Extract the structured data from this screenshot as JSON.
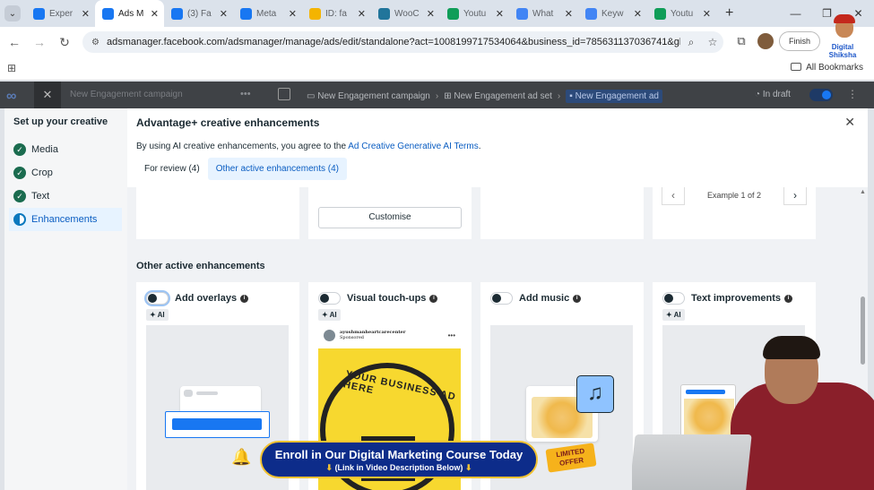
{
  "browser": {
    "tabs": [
      {
        "label": "Exper",
        "color": "#1877f2",
        "icon": "meta-icon"
      },
      {
        "label": "Ads M",
        "color": "#1877f2",
        "icon": "meta-icon",
        "active": true
      },
      {
        "label": "(3) Fa",
        "color": "#1877f2",
        "icon": "facebook-icon"
      },
      {
        "label": "Meta",
        "color": "#1877f2",
        "icon": "meta-icon"
      },
      {
        "label": "ID: fa",
        "color": "#f4b400",
        "icon": "drive-icon"
      },
      {
        "label": "WooC",
        "color": "#21759b",
        "icon": "wordpress-icon"
      },
      {
        "label": "Youtu",
        "color": "#0f9d58",
        "icon": "sheets-icon"
      },
      {
        "label": "What",
        "color": "#4285f4",
        "icon": "google-icon"
      },
      {
        "label": "Keyw",
        "color": "#4285f4",
        "icon": "google-ads-icon"
      },
      {
        "label": "Youtu",
        "color": "#0f9d58",
        "icon": "sheets-icon"
      }
    ],
    "url": "adsmanager.facebook.com/adsmanager/manage/ads/edit/standalone?act=1008199717534064&business_id=785631137036741&gl...",
    "finish_label": "Finish",
    "all_bookmarks": "All Bookmarks"
  },
  "ads_manager": {
    "campaign_label": "New Engagement campaign",
    "breadcrumbs": [
      "New Engagement campaign",
      "New Engagement ad set",
      "New Engagement ad"
    ],
    "status": "In draft"
  },
  "stepper": {
    "title": "Set up your creative",
    "steps": [
      {
        "label": "Media",
        "state": "done"
      },
      {
        "label": "Crop",
        "state": "done"
      },
      {
        "label": "Text",
        "state": "done"
      },
      {
        "label": "Enhancements",
        "state": "active"
      }
    ]
  },
  "modal": {
    "title": "Advantage+ creative enhancements",
    "desc_prefix": "By using AI creative enhancements, you agree to the ",
    "desc_link": "Ad Creative Generative AI Terms",
    "desc_suffix": ".",
    "tabs": [
      "For review (4)",
      "Other active enhancements (4)"
    ],
    "customise_label": "Customise",
    "example_label": "Example 1 of 2",
    "section_title": "Other active enhancements",
    "ai_badge": "AI",
    "cards": [
      {
        "title": "Add overlays"
      },
      {
        "title": "Visual touch-ups"
      },
      {
        "title": "Add music"
      },
      {
        "title": "Text improvements"
      }
    ],
    "sample_post": {
      "name": "ayushmanheartcarecenter",
      "sponsored": "Sponsored",
      "ad_text": "YOUR BUSINESS AD HERE",
      "ad_big": "AD"
    }
  },
  "video_overlay": {
    "line1": "Enroll in Our Digital Marketing Course Today",
    "line2": "(Link in Video Description Below)",
    "badge": "LIMITED OFFER",
    "brand": "Digital Shiksha"
  }
}
